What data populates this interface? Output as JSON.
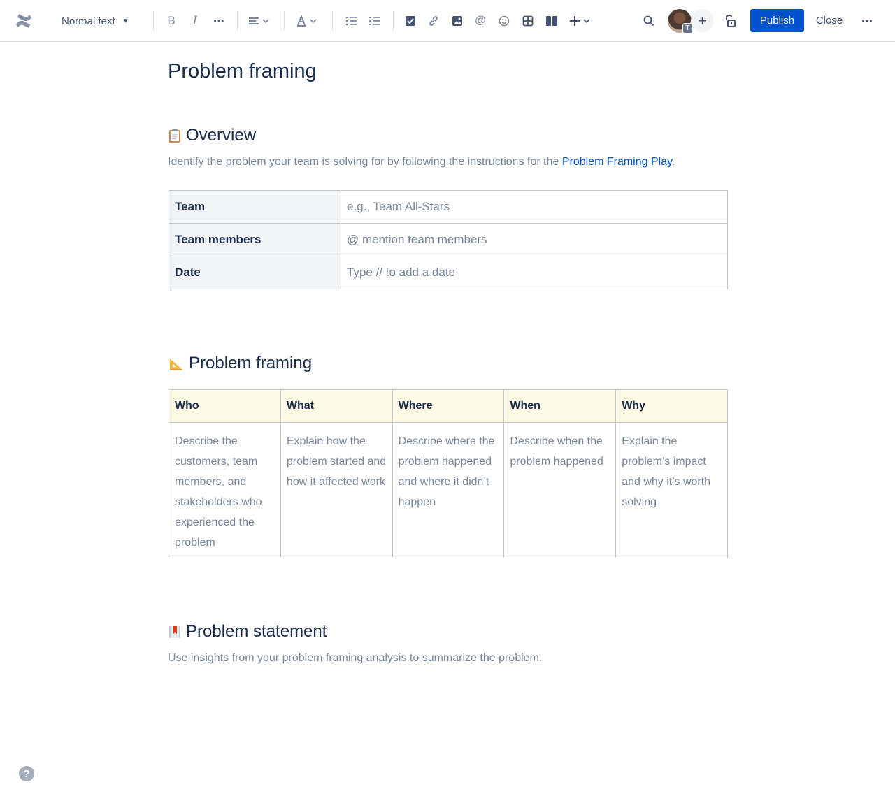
{
  "toolbar": {
    "text_style": "Normal text",
    "publish_label": "Publish",
    "close_label": "Close",
    "avatar_badge": "T",
    "icons": [
      "confluence-logo",
      "bold-icon",
      "italic-icon",
      "more-formatting-icon",
      "align-icon",
      "text-color-icon",
      "bullet-list-icon",
      "numbered-list-icon",
      "task-icon",
      "link-icon",
      "image-icon",
      "mention-icon",
      "emoji-icon",
      "table-icon",
      "layout-icon",
      "insert-icon",
      "search-icon",
      "invite-icon",
      "restrictions-icon",
      "more-icon"
    ],
    "accent": "#0052cc"
  },
  "page": {
    "title": "Problem framing"
  },
  "overview": {
    "heading": "Overview",
    "intro_prefix": "Identify the problem your team is solving for by following the instructions for the ",
    "intro_link": "Problem Framing Play",
    "intro_suffix": ".",
    "rows": [
      {
        "label": "Team",
        "placeholder": "e.g., Team All-Stars"
      },
      {
        "label": "Team members",
        "placeholder": "@ mention team members"
      },
      {
        "label": "Date",
        "placeholder": "Type // to add a date"
      }
    ]
  },
  "framing": {
    "heading": "Problem framing",
    "columns": [
      {
        "header": "Who",
        "text": "Describe the customers, team members, and stakeholders who experienced the problem"
      },
      {
        "header": "What",
        "text": "Explain how the problem started and how it affected work"
      },
      {
        "header": "Where",
        "text": "Describe where the problem happened and where it didn’t happen"
      },
      {
        "header": "When",
        "text": "Describe when the problem happened"
      },
      {
        "header": "Why",
        "text": "Explain the problem’s impact and why it’s worth solving"
      }
    ]
  },
  "statement": {
    "heading": "Problem statement",
    "text": "Use insights from your problem framing analysis to summarize the problem."
  },
  "help": {
    "label": "?"
  }
}
